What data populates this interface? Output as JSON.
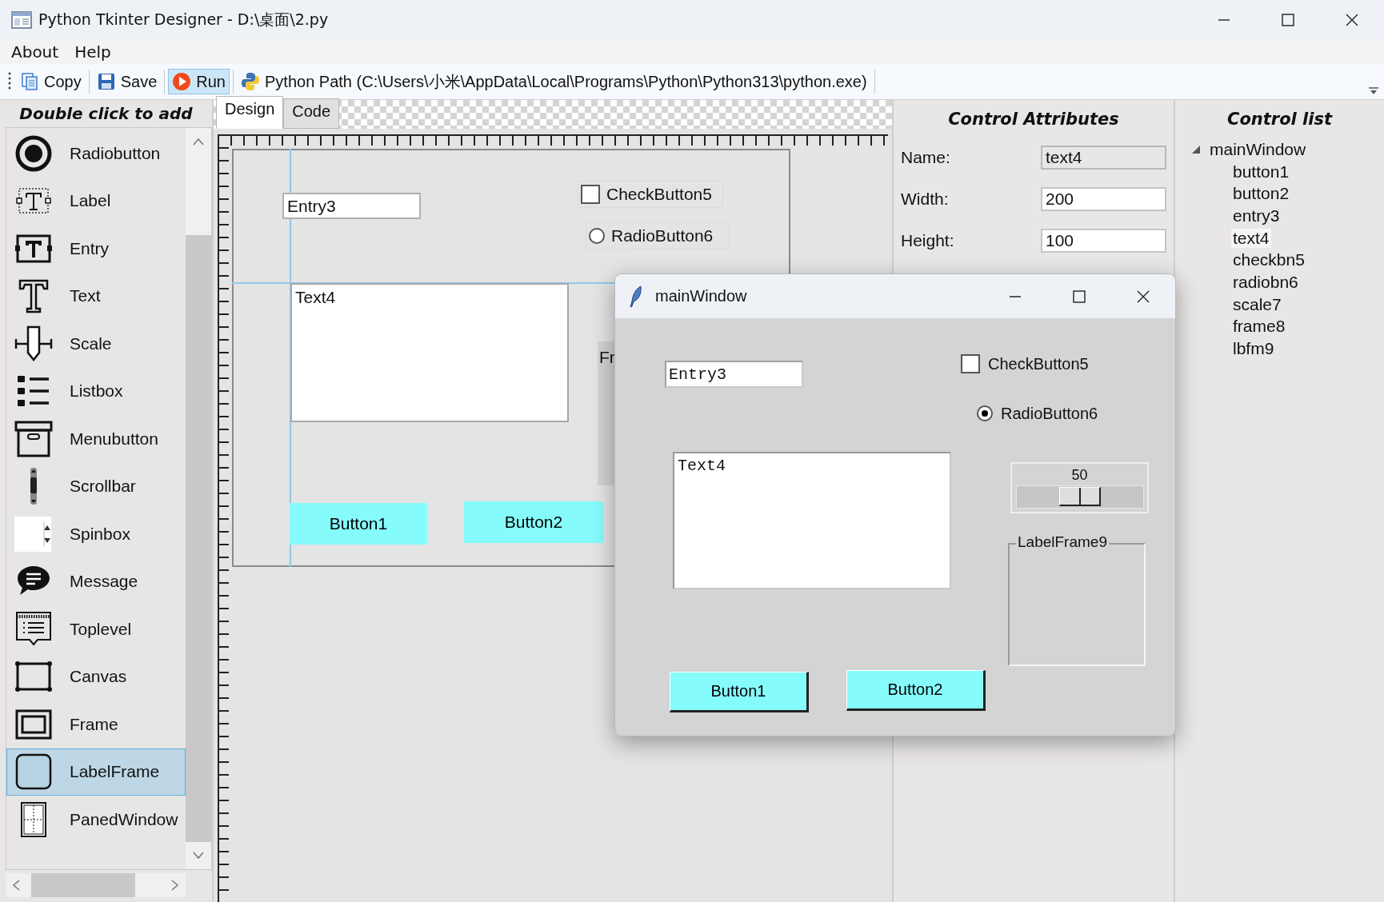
{
  "window": {
    "title": "Python Tkinter Designer - D:\\桌面\\2.py"
  },
  "menu": [
    "About",
    "Help"
  ],
  "toolbar": [
    {
      "label": "Copy",
      "kind": "copy",
      "selected": false
    },
    {
      "label": "Save",
      "kind": "save",
      "selected": false
    },
    {
      "label": "Run",
      "kind": "run",
      "selected": true
    },
    {
      "label": "Python Path (C:\\Users\\小米\\AppData\\Local\\Programs\\Python\\Python313\\python.exe)",
      "kind": "python",
      "selected": false
    }
  ],
  "palette": {
    "title": "Double click to add",
    "items": [
      {
        "label": "Radiobutton",
        "kind": "radiobutton",
        "selected": false
      },
      {
        "label": "Label",
        "kind": "label",
        "selected": false
      },
      {
        "label": "Entry",
        "kind": "entry",
        "selected": false
      },
      {
        "label": "Text",
        "kind": "text",
        "selected": false
      },
      {
        "label": "Scale",
        "kind": "scale",
        "selected": false
      },
      {
        "label": "Listbox",
        "kind": "listbox",
        "selected": false
      },
      {
        "label": "Menubutton",
        "kind": "menubutton",
        "selected": false
      },
      {
        "label": "Scrollbar",
        "kind": "scrollbar",
        "selected": false
      },
      {
        "label": "Spinbox",
        "kind": "spinbox",
        "selected": false
      },
      {
        "label": "Message",
        "kind": "message",
        "selected": false
      },
      {
        "label": "Toplevel",
        "kind": "toplevel",
        "selected": false
      },
      {
        "label": "Canvas",
        "kind": "canvas",
        "selected": false
      },
      {
        "label": "Frame",
        "kind": "frame",
        "selected": false
      },
      {
        "label": "LabelFrame",
        "kind": "labelframe",
        "selected": true
      },
      {
        "label": "PanedWindow",
        "kind": "panedwindow",
        "selected": false
      }
    ]
  },
  "tabs": [
    {
      "label": "Design",
      "selected": true
    },
    {
      "label": "Code",
      "selected": false
    }
  ],
  "design": {
    "widgets": [
      {
        "kind": "entry",
        "text": "Entry3"
      },
      {
        "kind": "checkbutton",
        "text": "CheckButton5",
        "checked": false
      },
      {
        "kind": "radiobutton",
        "text": "RadioButton6",
        "selected": false
      },
      {
        "kind": "text",
        "text": "Text4"
      },
      {
        "kind": "frame",
        "text": "Fr"
      },
      {
        "kind": "button",
        "text": "Button1"
      },
      {
        "kind": "button",
        "text": "Button2"
      }
    ]
  },
  "preview_window": {
    "title": "mainWindow",
    "widgets": [
      {
        "kind": "entry",
        "text": "Entry3"
      },
      {
        "kind": "checkbutton",
        "text": "CheckButton5",
        "checked": false
      },
      {
        "kind": "radiobutton",
        "text": "RadioButton6",
        "selected": true
      },
      {
        "kind": "text",
        "text": "Text4"
      },
      {
        "kind": "scale",
        "value": "50",
        "level": 0.5
      },
      {
        "kind": "labelframe",
        "text": "LabelFrame9"
      },
      {
        "kind": "button",
        "text": "Button1"
      },
      {
        "kind": "button",
        "text": "Button2"
      }
    ]
  },
  "attributes": {
    "title": "Control Attributes",
    "fields": [
      {
        "label": "Name:",
        "value": "text4",
        "disabled": true
      },
      {
        "label": "Width:",
        "value": "200",
        "disabled": false
      },
      {
        "label": "Height:",
        "value": "100",
        "disabled": false
      }
    ]
  },
  "control_list": {
    "title": "Control list",
    "tree": [
      {
        "label": "mainWindow",
        "expanded": true,
        "selected": false,
        "children": [
          {
            "label": "button1",
            "selected": false
          },
          {
            "label": "button2",
            "selected": false
          },
          {
            "label": "entry3",
            "selected": false
          },
          {
            "label": "text4",
            "selected": true
          },
          {
            "label": "checkbn5",
            "selected": false
          },
          {
            "label": "radiobn6",
            "selected": false
          },
          {
            "label": "scale7",
            "selected": false
          },
          {
            "label": "frame8",
            "selected": false
          },
          {
            "label": "lbfm9",
            "selected": false
          }
        ]
      }
    ]
  }
}
